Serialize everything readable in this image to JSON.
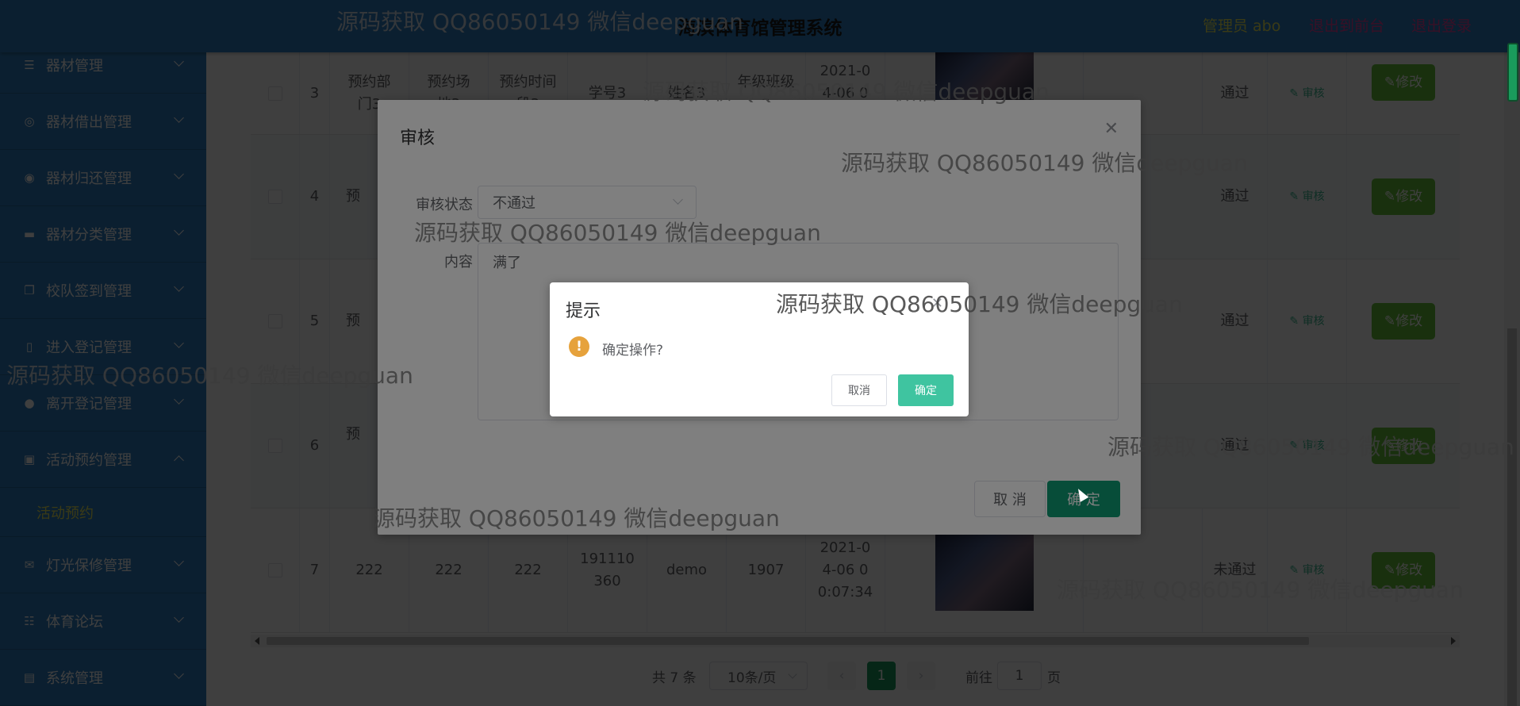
{
  "header": {
    "title": "海滨体育馆管理系统",
    "admin": "管理员 abo",
    "back_to_front": "退出到前台",
    "logout": "退出登录"
  },
  "sidebar": {
    "items": [
      {
        "label": "器材管理",
        "icon": "list-icon"
      },
      {
        "label": "器材借出管理",
        "icon": "compass-icon"
      },
      {
        "label": "器材归还管理",
        "icon": "target-icon"
      },
      {
        "label": "器材分类管理",
        "icon": "monitor-icon"
      },
      {
        "label": "校队签到管理",
        "icon": "copy-icon"
      },
      {
        "label": "进入登记管理",
        "icon": "mobile-icon"
      },
      {
        "label": "离开登记管理",
        "icon": "location-icon"
      },
      {
        "label": "活动预约管理",
        "icon": "briefcase-icon"
      },
      {
        "label": "灯光保修管理",
        "icon": "message-icon"
      },
      {
        "label": "体育论坛",
        "icon": "sliders-icon"
      },
      {
        "label": "系统管理",
        "icon": "clipboard-icon"
      }
    ],
    "submenu_label": "活动预约"
  },
  "table": {
    "rows": [
      {
        "index": "3",
        "dept": "预约部门3",
        "venue": "预约场地3",
        "period": "预约时间段3",
        "student_no": "学号3",
        "name": "姓名3",
        "grade": "年级班级3",
        "time": "2021-04-06 00:02:00",
        "status": "通过"
      },
      {
        "index": "4",
        "dept": "预",
        "venue": "",
        "period": "",
        "student_no": "",
        "name": "",
        "grade": "",
        "time": "",
        "status": "通过"
      },
      {
        "index": "5",
        "dept": "预",
        "venue": "",
        "period": "",
        "student_no": "",
        "name": "",
        "grade": "",
        "time": "",
        "status": "通过"
      },
      {
        "index": "6",
        "dept": "预",
        "venue": "",
        "period": "",
        "student_no": "",
        "name": "",
        "grade": "",
        "time": "",
        "status": "通过"
      },
      {
        "index": "7",
        "dept": "222",
        "venue": "222",
        "period": "222",
        "student_no": "191110360",
        "name": "demo",
        "grade": "1907",
        "time": "2021-04-06 00:07:34",
        "status": "未通过"
      }
    ],
    "review_link": "审核",
    "edit_label": "修改"
  },
  "pagination": {
    "total": "共 7 条",
    "page_size": "10条/页",
    "current_page": "1",
    "goto_label": "前往",
    "goto_value": "1",
    "page_suffix": "页"
  },
  "dialog": {
    "title": "审核",
    "status_label": "审核状态",
    "status_value": "不通过",
    "content_label": "内容",
    "content_value": "满了",
    "cancel": "取 消",
    "confirm": "确 定"
  },
  "messagebox": {
    "title": "提示",
    "message": "确定操作?",
    "cancel": "取消",
    "confirm": "确定"
  },
  "watermark": "源码获取 QQ86050149 微信deepguan",
  "colors": {
    "header_bg": "#2e7fc1",
    "sidebar_bg": "#2e7fc1",
    "accent_yellow": "#e8e85a",
    "accent_pink": "#e0439a",
    "primary": "#0e9a72",
    "edit_green": "#67c23a",
    "warning": "#e6a23c"
  }
}
